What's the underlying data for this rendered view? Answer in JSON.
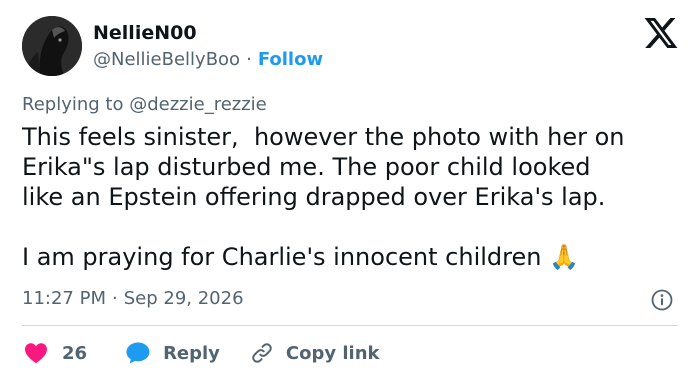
{
  "author": {
    "display_name": "NellieN00",
    "handle": "@NellieBellyBoo",
    "separator": "·",
    "follow_label": "Follow"
  },
  "reply": {
    "prefix": "Replying to",
    "mention": "@dezzie_rezzie"
  },
  "tweet": {
    "lines": [
      "This feels sinister,  however the photo with her on",
      "Erika\"s lap disturbed me. The poor child looked",
      "like an Epstein offering drapped over Erika's lap."
    ],
    "last_line": "I am praying for Charlie's innocent children",
    "emoji": "🙏"
  },
  "meta": {
    "time": "11:27 PM",
    "separator": "·",
    "date": "Sep 29, 2026"
  },
  "actions": {
    "like_count": "26",
    "reply_label": "Reply",
    "copy_link_label": "Copy link"
  },
  "colors": {
    "accent": "#1d9bf0",
    "like": "#f91880",
    "text": "#0f1419",
    "muted": "#536471",
    "divider": "#cfd9de"
  },
  "icons": [
    "x-logo-icon",
    "info-icon",
    "heart-icon",
    "reply-bubble-icon",
    "link-icon",
    "praying-hands-emoji"
  ]
}
